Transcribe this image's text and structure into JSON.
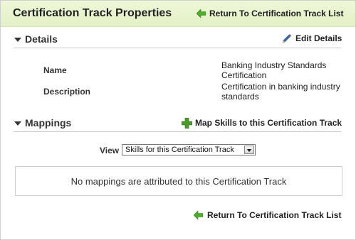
{
  "header": {
    "title": "Certification Track Properties",
    "return_link": "Return To Certification Track List"
  },
  "details": {
    "section_title": "Details",
    "edit_link": "Edit Details",
    "fields": [
      {
        "label": "Name",
        "value": "Banking Industry Standards Certification"
      },
      {
        "label": "Description",
        "value": "Certification in banking industry standards"
      }
    ]
  },
  "mappings": {
    "section_title": "Mappings",
    "map_link": "Map Skills to this Certification Track",
    "view_label": "View",
    "view_selected": "Skills for this Certification Track",
    "empty_message": "No mappings are attributed to this Certification Track"
  },
  "footer": {
    "return_link": "Return To Certification Track List"
  },
  "colors": {
    "header_bg": "#e3f0c6",
    "arrow_green": "#4caf2a",
    "plus_green": "#4a9a2c",
    "pencil_blue": "#3a6fb5"
  },
  "icons": [
    "left-arrow-icon",
    "pencil-icon",
    "collapse-triangle-icon",
    "plus-icon",
    "dropdown-arrow-icon"
  ]
}
